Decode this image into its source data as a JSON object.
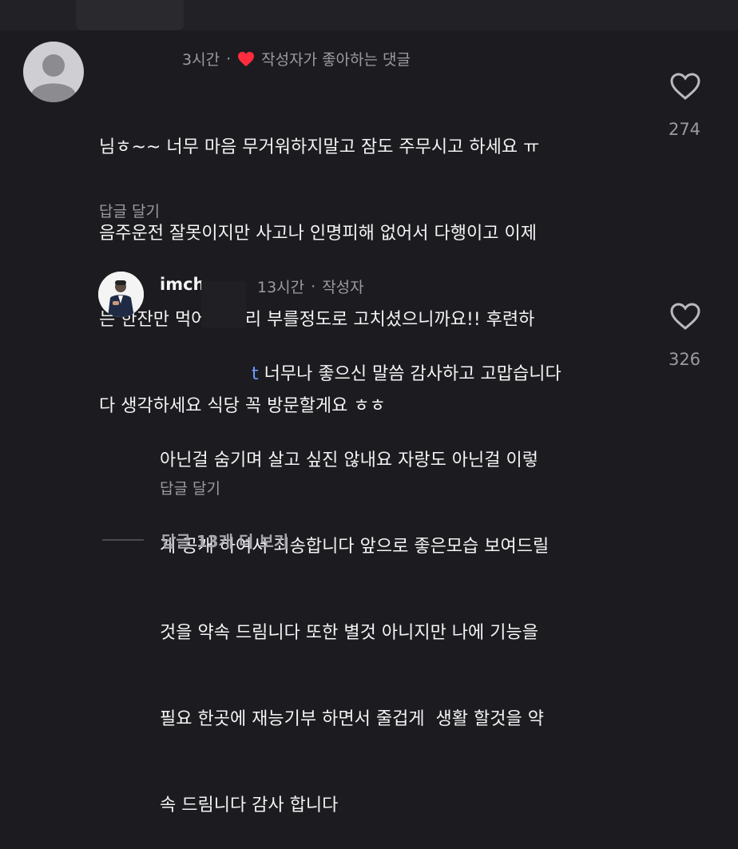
{
  "comment": {
    "time": "3시간",
    "separator": "·",
    "liked_by_author_label": "작성자가 좋아하는 댓글",
    "text_lines": [
      "님ㅎ~~ 너무 마음 무거워하지말고 잠도 주무시고 하세요 ㅠ",
      "음주운전 잘못이지만 사고나 인명피해 없어서 다행이고 이제",
      "는 한잔만 먹어도 대리 부를정도로 고치셨으니까요!! 후련하",
      "다 생각하세요 식당 꼭 방문할게요 ㅎㅎ"
    ],
    "reply_label": "답글 달기",
    "like_count": "274",
    "heart_color": "#ff2d3d"
  },
  "reply": {
    "username": "imch",
    "time": "13시간",
    "separator": "·",
    "author_badge": "작성자",
    "mention": "t",
    "text_lines": [
      " 너무나 좋으신 말씀 감사하고 고맙습니다",
      "아닌걸 숨기며 살고 싶진 않내요 자랑도 아닌걸 이렇",
      "게 공개 하여서 죄송합니다 앞으로 좋은모습 보여드릴",
      "것을 약속 드림니다 또한 별것 아니지만 나에 기능을",
      "필요 한곳에 재능기부 하면서 줄겁게  생활 할것을 약",
      "속 드림니다 감사 합니다"
    ],
    "reply_label": "답글 달기",
    "like_count": "326"
  },
  "more_replies_label": "답글 13개 더 보기",
  "colors": {
    "background": "#1c1c20",
    "text": "#f4f4f4",
    "muted": "#9a9aa0",
    "mention": "#6f9cff"
  }
}
